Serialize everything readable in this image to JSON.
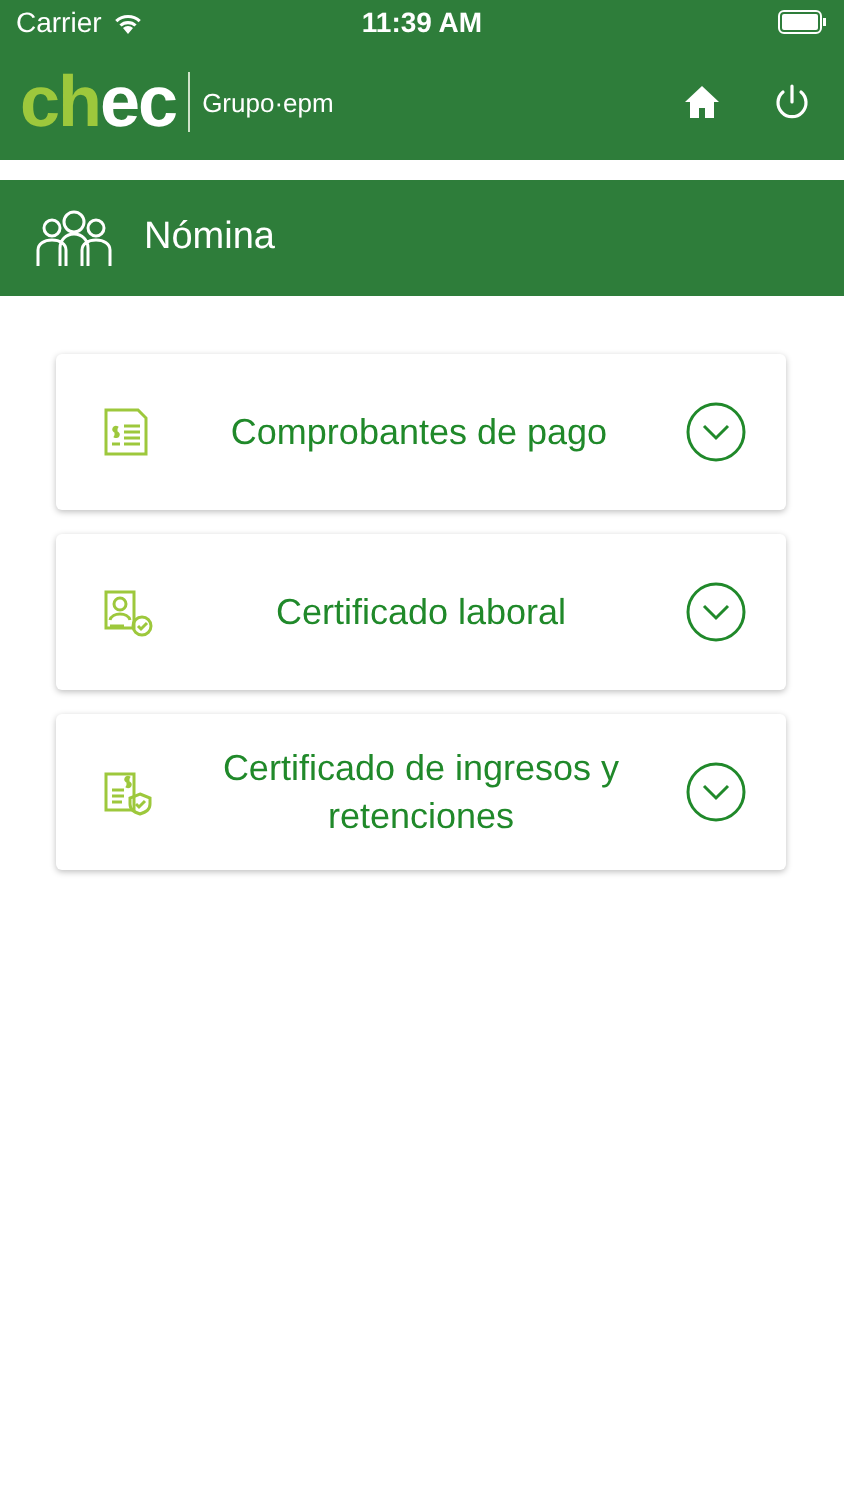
{
  "status_bar": {
    "carrier": "Carrier",
    "time": "11:39 AM"
  },
  "header": {
    "logo": {
      "lead": "ch",
      "rest": "ec",
      "group": "Grupo·epm"
    }
  },
  "section": {
    "title": "Nómina"
  },
  "items": [
    {
      "kind": "receipt",
      "label": "Comprobantes de pago",
      "expanded": false
    },
    {
      "kind": "employee",
      "label": "Certificado laboral",
      "expanded": false
    },
    {
      "kind": "income",
      "label": "Certificado de ingresos y retenciones",
      "expanded": false
    }
  ]
}
